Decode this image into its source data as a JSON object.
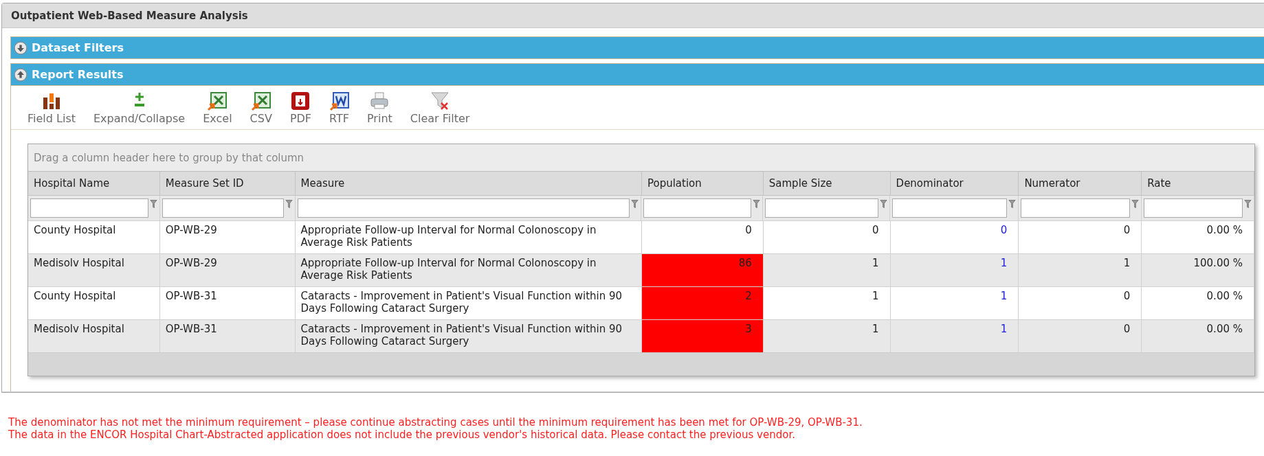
{
  "window": {
    "title": "Outpatient Web-Based Measure Analysis"
  },
  "sections": [
    {
      "title": "Dataset Filters",
      "expanded": false
    },
    {
      "title": "Report Results",
      "expanded": true
    }
  ],
  "toolbar": [
    {
      "kind": "fieldlist",
      "label": "Field List"
    },
    {
      "kind": "expand",
      "label": "Expand/Collapse"
    },
    {
      "kind": "excel",
      "label": "Excel"
    },
    {
      "kind": "csv",
      "label": "CSV"
    },
    {
      "kind": "pdf",
      "label": "PDF"
    },
    {
      "kind": "rtf",
      "label": "RTF"
    },
    {
      "kind": "print",
      "label": "Print"
    },
    {
      "kind": "clearfilter",
      "label": "Clear Filter"
    }
  ],
  "grid": {
    "group_hint": "Drag a column header here to group by that column",
    "columns": [
      "Hospital Name",
      "Measure Set ID",
      "Measure",
      "Population",
      "Sample Size",
      "Denominator",
      "Numerator",
      "Rate"
    ],
    "rows": [
      {
        "cells": [
          "County Hospital",
          "OP-WB-29",
          "Appropriate Follow-up Interval for Normal Colonoscopy in Average Risk Patients",
          "0",
          "0",
          "0",
          "0",
          "0.00 %"
        ],
        "population_flagged": false
      },
      {
        "cells": [
          "Medisolv Hospital",
          "OP-WB-29",
          "Appropriate Follow-up Interval for Normal Colonoscopy in Average Risk Patients",
          "86",
          "1",
          "1",
          "1",
          "100.00 %"
        ],
        "population_flagged": true
      },
      {
        "cells": [
          "County Hospital",
          "OP-WB-31",
          "Cataracts - Improvement in Patient's Visual Function within 90 Days Following Cataract Surgery",
          "2",
          "1",
          "1",
          "0",
          "0.00 %"
        ],
        "population_flagged": true
      },
      {
        "cells": [
          "Medisolv Hospital",
          "OP-WB-31",
          "Cataracts - Improvement in Patient's Visual Function within 90 Days Following Cataract Surgery",
          "3",
          "1",
          "1",
          "0",
          "0.00 %"
        ],
        "population_flagged": true
      }
    ]
  },
  "messages": [
    "The denominator has not met the minimum requirement – please continue abstracting cases until the minimum requirement has been met for OP-WB-29, OP-WB-31.",
    "The data in the ENCOR Hospital Chart-Abstracted application does not include the previous vendor's historical data. Please contact the previous vendor."
  ]
}
